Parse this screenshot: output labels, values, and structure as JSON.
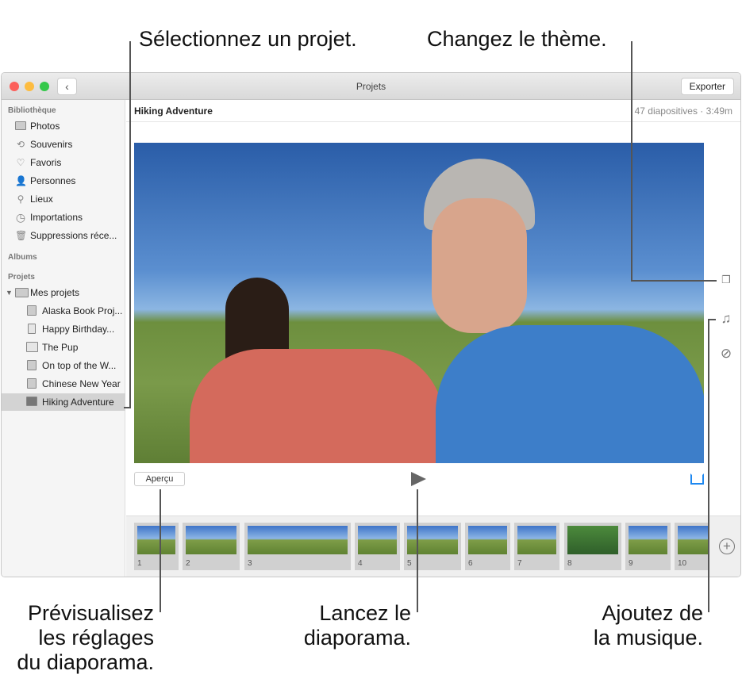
{
  "callouts": {
    "select_project": "Sélectionnez un projet.",
    "change_theme": "Changez le thème.",
    "preview": [
      "Prévisualisez",
      "les réglages",
      "du diaporama."
    ],
    "play": [
      "Lancez le",
      "diaporama."
    ],
    "music": [
      "Ajoutez de",
      "la musique."
    ]
  },
  "window": {
    "title": "Projets",
    "export_label": "Exporter"
  },
  "sidebar": {
    "library_header": "Bibliothèque",
    "library": [
      {
        "label": "Photos",
        "icon": "photos-icon"
      },
      {
        "label": "Souvenirs",
        "icon": "memories-icon"
      },
      {
        "label": "Favoris",
        "icon": "heart-icon"
      },
      {
        "label": "Personnes",
        "icon": "person-icon"
      },
      {
        "label": "Lieux",
        "icon": "pin-icon"
      },
      {
        "label": "Importations",
        "icon": "clock-icon"
      },
      {
        "label": "Suppressions réce...",
        "icon": "trash-icon"
      }
    ],
    "albums_header": "Albums",
    "projects_header": "Projets",
    "folder": "Mes projets",
    "projects": [
      "Alaska Book Proj...",
      "Happy Birthday...",
      "The Pup",
      "On top of the W...",
      "Chinese New Year",
      "Hiking Adventure"
    ]
  },
  "main": {
    "project_title": "Hiking Adventure",
    "info": "47 diapositives · 3:49m",
    "preview_label": "Aperçu"
  },
  "filmstrip": [
    "1",
    "2",
    "3",
    "4",
    "5",
    "6",
    "7",
    "8",
    "9",
    "10"
  ],
  "colors": {
    "accent": "#1e88f0",
    "selected": "#d3d3d3"
  }
}
